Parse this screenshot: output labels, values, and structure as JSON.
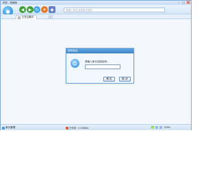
{
  "window": {
    "title": "网页 - 极速版",
    "controls": [
      "–",
      "□",
      "×"
    ]
  },
  "toolbar": {
    "search_placeholder": "请输入网址或搜索关键字"
  },
  "tabs": [
    {
      "label": "正在加载中"
    }
  ],
  "dialog": {
    "title": "密码验证",
    "prompt": "请输入家长控制密码：",
    "ok_label": "确 定",
    "cancel_label": "取 消"
  },
  "statusbar": {
    "left_label": "家长管理",
    "mid_text": "已完成 · 0.00KB/s",
    "right_text": "100%"
  },
  "colors": {
    "accent": "#3f86c8",
    "frame": "#7fa9d6",
    "chrome": "#d6e7f8"
  },
  "icons": [
    "logo-icon",
    "back-icon",
    "forward-icon",
    "refresh-icon",
    "fire-icon",
    "shield-icon",
    "close-tab-icon",
    "add-tab-icon",
    "mascot-icon",
    "status-icon",
    "speed-icon"
  ]
}
